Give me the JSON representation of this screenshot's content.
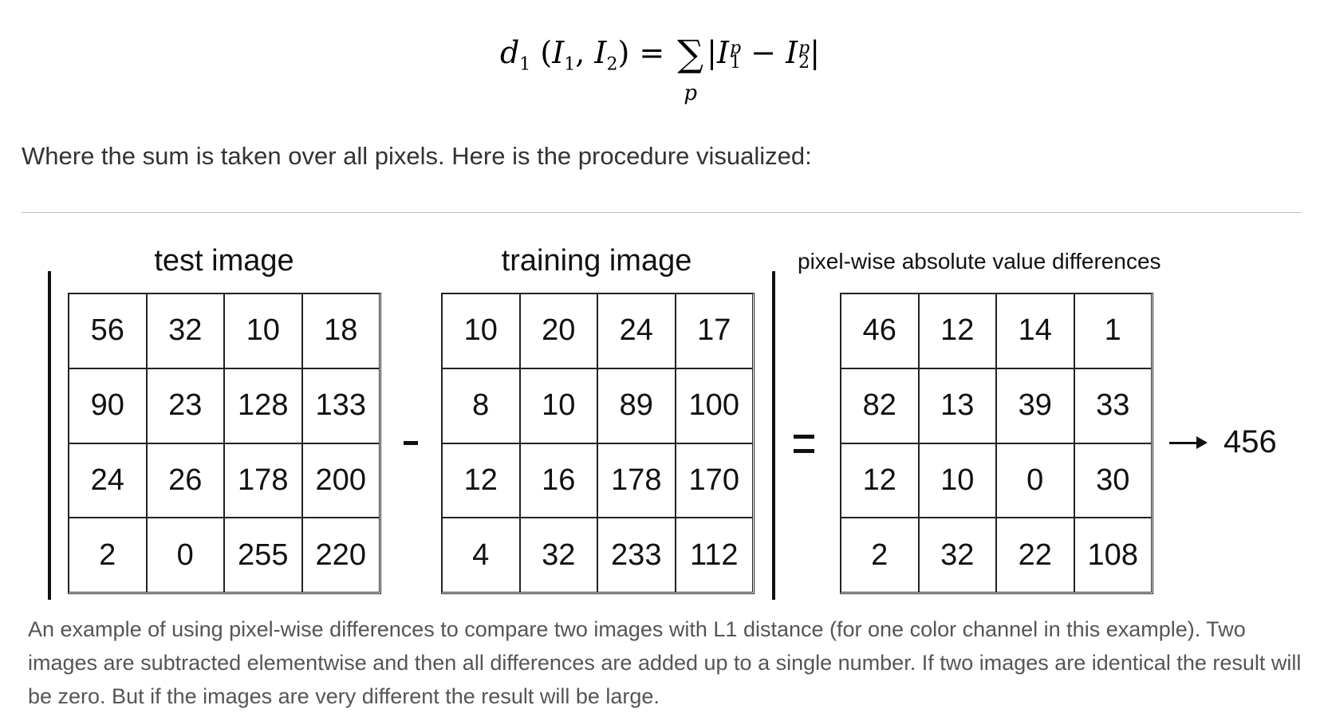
{
  "formula": {
    "lhs": "d",
    "lhs_sub": "1",
    "args_open": "(",
    "arg1": "I",
    "arg1_sub": "1",
    "comma": ",",
    "arg2": "I",
    "arg2_sub": "2",
    "args_close": ")",
    "equals": "=",
    "sum": "∑",
    "sum_index": "p",
    "abs_open": "|",
    "term1": "I",
    "term1_sup": "p",
    "term1_sub": "1",
    "minus": "−",
    "term2": "I",
    "term2_sup": "p",
    "term2_sub": "2",
    "abs_close": "|"
  },
  "description": "Where the sum is taken over all pixels. Here is the procedure visualized:",
  "figure": {
    "test_title": "test image",
    "train_title": "training image",
    "diff_title": "pixel-wise absolute value differences",
    "test": [
      [
        "56",
        "32",
        "10",
        "18"
      ],
      [
        "90",
        "23",
        "128",
        "133"
      ],
      [
        "24",
        "26",
        "178",
        "200"
      ],
      [
        "2",
        "0",
        "255",
        "220"
      ]
    ],
    "train": [
      [
        "10",
        "20",
        "24",
        "17"
      ],
      [
        "8",
        "10",
        "89",
        "100"
      ],
      [
        "12",
        "16",
        "178",
        "170"
      ],
      [
        "4",
        "32",
        "233",
        "112"
      ]
    ],
    "diff": [
      [
        "46",
        "12",
        "14",
        "1"
      ],
      [
        "82",
        "13",
        "39",
        "33"
      ],
      [
        "12",
        "10",
        "0",
        "30"
      ],
      [
        "2",
        "32",
        "22",
        "108"
      ]
    ],
    "result": "456"
  },
  "caption": "An example of using pixel-wise differences to compare two images with L1 distance (for one color channel in this example). Two images are subtracted elementwise and then all differences are added up to a single number. If two images are identical the result will be zero. But if the images are very different the result will be large."
}
